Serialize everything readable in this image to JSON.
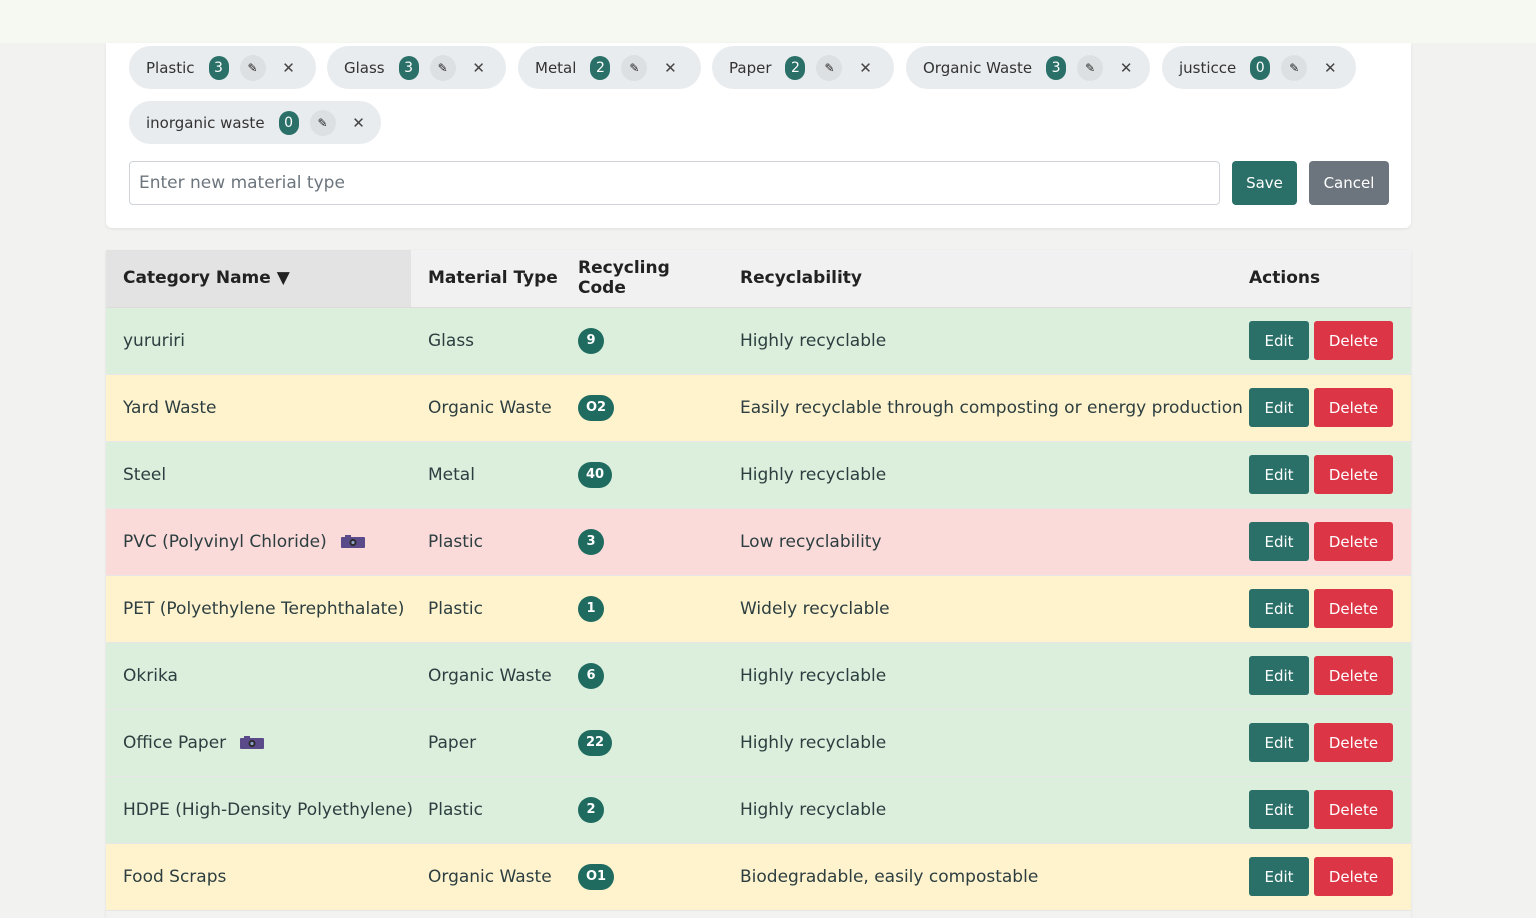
{
  "material_types": [
    {
      "label": "Plastic",
      "count": "3"
    },
    {
      "label": "Glass",
      "count": "3"
    },
    {
      "label": "Metal",
      "count": "2"
    },
    {
      "label": "Paper",
      "count": "2"
    },
    {
      "label": "Organic Waste",
      "count": "3"
    },
    {
      "label": "justicce",
      "count": "0"
    },
    {
      "label": "inorganic waste",
      "count": "0"
    }
  ],
  "new_material": {
    "placeholder": "Enter new material type",
    "save_label": "Save",
    "cancel_label": "Cancel"
  },
  "table": {
    "headers": {
      "category": "Category Name ▼",
      "material": "Material Type",
      "code": "Recycling Code",
      "recyclability": "Recyclability",
      "actions": "Actions"
    },
    "edit_label": "Edit",
    "delete_label": "Delete",
    "rows": [
      {
        "name": "yururiri",
        "material": "Glass",
        "code": "9",
        "recyclability": "Highly recyclable",
        "status": "green",
        "has_image": false
      },
      {
        "name": "Yard Waste",
        "material": "Organic Waste",
        "code": "O2",
        "recyclability": "Easily recyclable through composting or energy production",
        "status": "yellow",
        "has_image": false
      },
      {
        "name": "Steel",
        "material": "Metal",
        "code": "40",
        "recyclability": "Highly recyclable",
        "status": "green",
        "has_image": false
      },
      {
        "name": "PVC (Polyvinyl Chloride)",
        "material": "Plastic",
        "code": "3",
        "recyclability": "Low recyclability",
        "status": "red",
        "has_image": true
      },
      {
        "name": "PET (Polyethylene Terephthalate)",
        "material": "Plastic",
        "code": "1",
        "recyclability": "Widely recyclable",
        "status": "yellow",
        "has_image": false
      },
      {
        "name": "Okrika",
        "material": "Organic Waste",
        "code": "6",
        "recyclability": "Highly recyclable",
        "status": "green",
        "has_image": false
      },
      {
        "name": "Office Paper",
        "material": "Paper",
        "code": "22",
        "recyclability": "Highly recyclable",
        "status": "green",
        "has_image": true
      },
      {
        "name": "HDPE (High-Density Polyethylene)",
        "material": "Plastic",
        "code": "2",
        "recyclability": "Highly recyclable",
        "status": "green",
        "has_image": false
      },
      {
        "name": "Food Scraps",
        "material": "Organic Waste",
        "code": "O1",
        "recyclability": "Biodegradable, easily compostable",
        "status": "yellow",
        "has_image": false
      }
    ]
  },
  "colors": {
    "primary": "#2a7068",
    "danger": "#dc3545",
    "secondary": "#6c757d",
    "row_green": "#dcefdc",
    "row_yellow": "#fff3cd",
    "row_red": "#fbdada"
  },
  "icons": {
    "edit_chip": "pencil-icon",
    "remove_chip": "close-icon",
    "row_image": "camera-icon"
  }
}
